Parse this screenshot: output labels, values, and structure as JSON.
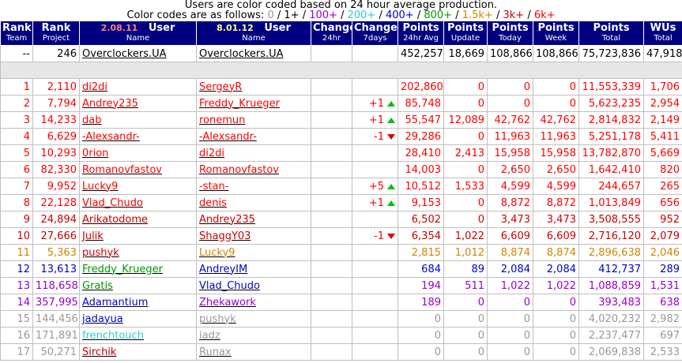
{
  "header": {
    "line1": "Users are color coded based on 24 hour average production.",
    "legend_prefix": "Color codes are as follows:",
    "legend": [
      {
        "label": "0",
        "color": "#999999"
      },
      {
        "label": "1+",
        "color": "#000000"
      },
      {
        "label": "100+",
        "color": "#9900cc"
      },
      {
        "label": "200+",
        "color": "#33cccc"
      },
      {
        "label": "400+",
        "color": "#0000cc"
      },
      {
        "label": "800+",
        "color": "#009900"
      },
      {
        "label": "1.5k+",
        "color": "#cc8800"
      },
      {
        "label": "3k+",
        "color": "#cc0000"
      },
      {
        "label": "6k+",
        "color": "#ff0000"
      }
    ]
  },
  "columns": {
    "rank_team": {
      "top": "Rank",
      "sub": "Team"
    },
    "rank_project": {
      "top": "Rank",
      "sub": "Project"
    },
    "user1": {
      "date": "2.08.11",
      "top": "User",
      "sub": "Name"
    },
    "user2": {
      "date": "8.01.12",
      "top": "User",
      "sub": "Name"
    },
    "change24": {
      "top": "Change",
      "sub": "24hr"
    },
    "change7": {
      "top": "Change",
      "sub": "7days"
    },
    "pts24": {
      "top": "Points",
      "sub": "24hr Avg"
    },
    "ptsupd": {
      "top": "Points",
      "sub": "Update"
    },
    "ptstoday": {
      "top": "Points",
      "sub": "Today"
    },
    "ptsweek": {
      "top": "Points",
      "sub": "Week"
    },
    "ptstotal": {
      "top": "Points",
      "sub": "Total"
    },
    "wus": {
      "top": "WUs",
      "sub": "Total"
    }
  },
  "team_row": {
    "rank_team": "--",
    "rank_project": "246",
    "user1": "Overclockers.UA",
    "user2": "Overclockers.UA",
    "pts24": "452,257",
    "ptsupd": "18,669",
    "ptstoday": "108,866",
    "ptsweek": "108,866",
    "ptstotal": "75,723,836",
    "wus": "47,918"
  },
  "rows": [
    {
      "rank": "1",
      "proj": "2,110",
      "u1": "di2di",
      "u1c": "#ff0000",
      "u2": "SergeyR",
      "u2c": "#ff0000",
      "chg": "",
      "dir": "",
      "p24": "202,860",
      "upd": "0",
      "today": "0",
      "week": "0",
      "total": "11,553,339",
      "wus": "1,706",
      "c": "#ff0000"
    },
    {
      "rank": "2",
      "proj": "7,794",
      "u1": "Andrey235",
      "u1c": "#ff0000",
      "u2": "Freddy_Krueger",
      "u2c": "#ff0000",
      "chg": "+1",
      "dir": "up",
      "p24": "85,748",
      "upd": "0",
      "today": "0",
      "week": "0",
      "total": "5,623,235",
      "wus": "2,954",
      "c": "#ff0000"
    },
    {
      "rank": "3",
      "proj": "14,233",
      "u1": "dab",
      "u1c": "#ff0000",
      "u2": "ronemun",
      "u2c": "#ff0000",
      "chg": "+1",
      "dir": "up",
      "p24": "55,547",
      "upd": "12,089",
      "today": "42,762",
      "week": "42,762",
      "total": "2,814,832",
      "wus": "2,149",
      "c": "#ff0000"
    },
    {
      "rank": "4",
      "proj": "6,629",
      "u1": "-Alexsandr-",
      "u1c": "#ff0000",
      "u2": "-Alexsandr-",
      "u2c": "#ff0000",
      "chg": "-1",
      "dir": "down",
      "p24": "29,286",
      "upd": "0",
      "today": "11,963",
      "week": "11,963",
      "total": "5,251,178",
      "wus": "5,411",
      "c": "#ff0000"
    },
    {
      "rank": "5",
      "proj": "10,293",
      "u1": "0rion",
      "u1c": "#ff0000",
      "u2": "di2di",
      "u2c": "#ff0000",
      "chg": "",
      "dir": "",
      "p24": "28,410",
      "upd": "2,413",
      "today": "15,958",
      "week": "15,958",
      "total": "13,782,870",
      "wus": "5,669",
      "c": "#ff0000"
    },
    {
      "rank": "6",
      "proj": "82,330",
      "u1": "Romanovfastov",
      "u1c": "#ff0000",
      "u2": "Romanovfastov",
      "u2c": "#ff0000",
      "chg": "",
      "dir": "",
      "p24": "14,003",
      "upd": "0",
      "today": "2,650",
      "week": "2,650",
      "total": "1,642,410",
      "wus": "820",
      "c": "#ff0000"
    },
    {
      "rank": "7",
      "proj": "9,952",
      "u1": "Lucky9",
      "u1c": "#ff0000",
      "u2": "-stan-",
      "u2c": "#ff0000",
      "chg": "+5",
      "dir": "up",
      "p24": "10,512",
      "upd": "1,533",
      "today": "4,599",
      "week": "4,599",
      "total": "244,657",
      "wus": "265",
      "c": "#ff0000"
    },
    {
      "rank": "8",
      "proj": "22,128",
      "u1": "Vlad_Chudo",
      "u1c": "#ff0000",
      "u2": "denis",
      "u2c": "#ff0000",
      "chg": "+1",
      "dir": "up",
      "p24": "9,153",
      "upd": "0",
      "today": "8,872",
      "week": "8,872",
      "total": "1,013,849",
      "wus": "656",
      "c": "#ff0000"
    },
    {
      "rank": "9",
      "proj": "24,894",
      "u1": "Arikatodome",
      "u1c": "#cc0000",
      "u2": "Andrey235",
      "u2c": "#cc0000",
      "chg": "",
      "dir": "",
      "p24": "6,502",
      "upd": "0",
      "today": "3,473",
      "week": "3,473",
      "total": "3,508,555",
      "wus": "952",
      "c": "#cc0000"
    },
    {
      "rank": "10",
      "proj": "27,666",
      "u1": "Julik",
      "u1c": "#cc0000",
      "u2": "ShaggY03",
      "u2c": "#cc0000",
      "chg": "-1",
      "dir": "down",
      "p24": "6,354",
      "upd": "1,022",
      "today": "6,609",
      "week": "6,609",
      "total": "2,716,120",
      "wus": "2,079",
      "c": "#cc0000"
    },
    {
      "rank": "11",
      "proj": "5,363",
      "u1": "pushyk",
      "u1c": "#cc0000",
      "u2": "Lucky9",
      "u2c": "#cc8800",
      "chg": "",
      "dir": "",
      "p24": "2,815",
      "upd": "1,012",
      "today": "8,874",
      "week": "8,874",
      "total": "2,896,638",
      "wus": "2,046",
      "c": "#cc8800"
    },
    {
      "rank": "12",
      "proj": "13,613",
      "u1": "Freddy_Krueger",
      "u1c": "#009900",
      "u2": "AndreyIM",
      "u2c": "#0000cc",
      "chg": "",
      "dir": "",
      "p24": "684",
      "upd": "89",
      "today": "2,084",
      "week": "2,084",
      "total": "412,737",
      "wus": "289",
      "c": "#0000cc"
    },
    {
      "rank": "13",
      "proj": "118,658",
      "u1": "Gratis",
      "u1c": "#009900",
      "u2": "Vlad_Chudo",
      "u2c": "#0000cc",
      "chg": "",
      "dir": "",
      "p24": "194",
      "upd": "511",
      "today": "1,022",
      "week": "1,022",
      "total": "1,088,859",
      "wus": "1,531",
      "c": "#9900cc"
    },
    {
      "rank": "14",
      "proj": "357,995",
      "u1": "Adamantium",
      "u1c": "#0000cc",
      "u2": "Zhekawork",
      "u2c": "#9900cc",
      "chg": "",
      "dir": "",
      "p24": "189",
      "upd": "0",
      "today": "0",
      "week": "0",
      "total": "393,483",
      "wus": "638",
      "c": "#9900cc"
    },
    {
      "rank": "15",
      "proj": "144,456",
      "u1": "jadayua",
      "u1c": "#0000cc",
      "u2": "pushyk",
      "u2c": "#999999",
      "chg": "",
      "dir": "",
      "p24": "0",
      "upd": "0",
      "today": "0",
      "week": "0",
      "total": "4,020,232",
      "wus": "2,982",
      "c": "#999999"
    },
    {
      "rank": "16",
      "proj": "171,891",
      "u1": "frenchtouch",
      "u1c": "#33cccc",
      "u2": "iadz",
      "u2c": "#999999",
      "chg": "",
      "dir": "",
      "p24": "0",
      "upd": "0",
      "today": "0",
      "week": "0",
      "total": "2,237,477",
      "wus": "697",
      "c": "#999999"
    },
    {
      "rank": "17",
      "proj": "50,271",
      "u1": "Sirchik",
      "u1c": "#cc0000",
      "u2": "Runax",
      "u2c": "#999999",
      "chg": "",
      "dir": "",
      "p24": "0",
      "upd": "0",
      "today": "0",
      "week": "0",
      "total": "2,069,838",
      "wus": "2,533",
      "c": "#999999"
    }
  ]
}
